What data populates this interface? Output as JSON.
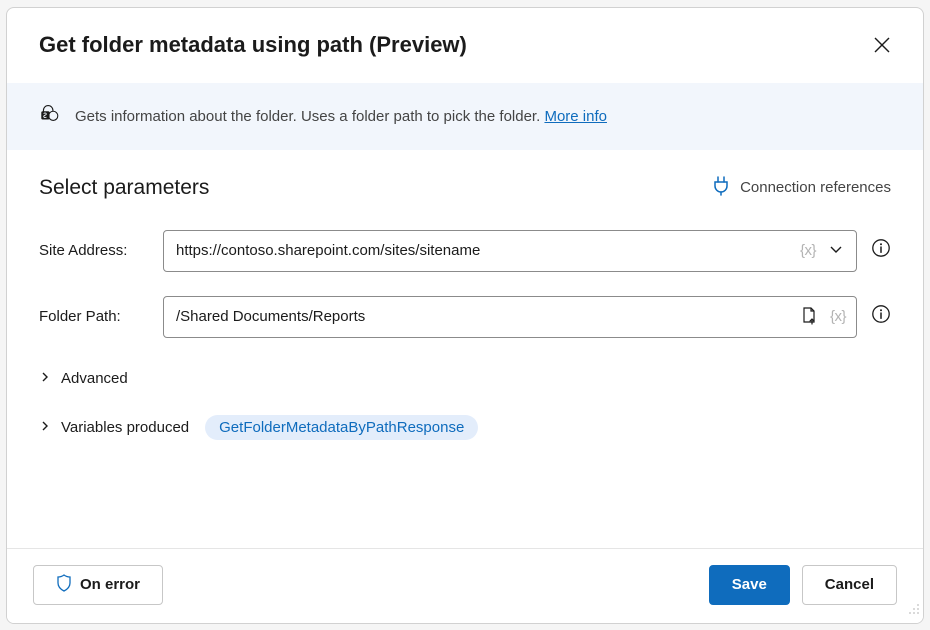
{
  "header": {
    "title": "Get folder metadata using path (Preview)"
  },
  "banner": {
    "text": "Gets information about the folder. Uses a folder path to pick the folder. ",
    "link_label": "More info"
  },
  "section": {
    "title": "Select parameters",
    "connection_references_label": "Connection references"
  },
  "params": {
    "site_address": {
      "label": "Site Address:",
      "value": "https://contoso.sharepoint.com/sites/sitename",
      "var_token": "{x}"
    },
    "folder_path": {
      "label": "Folder Path:",
      "value": "/Shared Documents/Reports",
      "var_token": "{x}"
    }
  },
  "expanders": {
    "advanced": "Advanced",
    "variables_produced": "Variables produced",
    "variable_pill": "GetFolderMetadataByPathResponse"
  },
  "footer": {
    "on_error": "On error",
    "save": "Save",
    "cancel": "Cancel"
  }
}
